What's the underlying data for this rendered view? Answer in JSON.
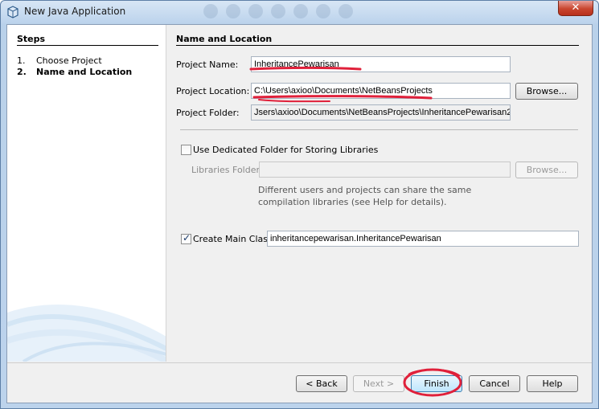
{
  "window": {
    "title": "New Java Application",
    "close_label": "✕"
  },
  "steps": {
    "heading": "Steps",
    "items": [
      {
        "num": "1.",
        "label": "Choose Project"
      },
      {
        "num": "2.",
        "label": "Name and Location"
      }
    ]
  },
  "content": {
    "heading": "Name and Location",
    "project_name": {
      "label": "Project Name:",
      "value": "InheritancePewarisan"
    },
    "project_location": {
      "label": "Project Location:",
      "value": "C:\\Users\\axioo\\Documents\\NetBeansProjects",
      "browse": "Browse..."
    },
    "project_folder": {
      "label": "Project Folder:",
      "value": "Jsers\\axioo\\Documents\\NetBeansProjects\\InheritancePewarisan2"
    },
    "dedicated_folder": {
      "label": "Use Dedicated Folder for Storing Libraries",
      "checked": false
    },
    "libraries_folder": {
      "label": "Libraries Folder:",
      "value": "",
      "browse": "Browse..."
    },
    "hint": "Different users and projects can share the same compilation libraries (see Help for details).",
    "main_class": {
      "label": "Create Main Class",
      "checked": true,
      "value": "inheritancepewarisan.InheritancePewarisan"
    }
  },
  "buttons": {
    "back": "< Back",
    "next": "Next >",
    "finish": "Finish",
    "cancel": "Cancel",
    "help": "Help"
  },
  "colors": {
    "annotation_red": "#e0203a"
  }
}
